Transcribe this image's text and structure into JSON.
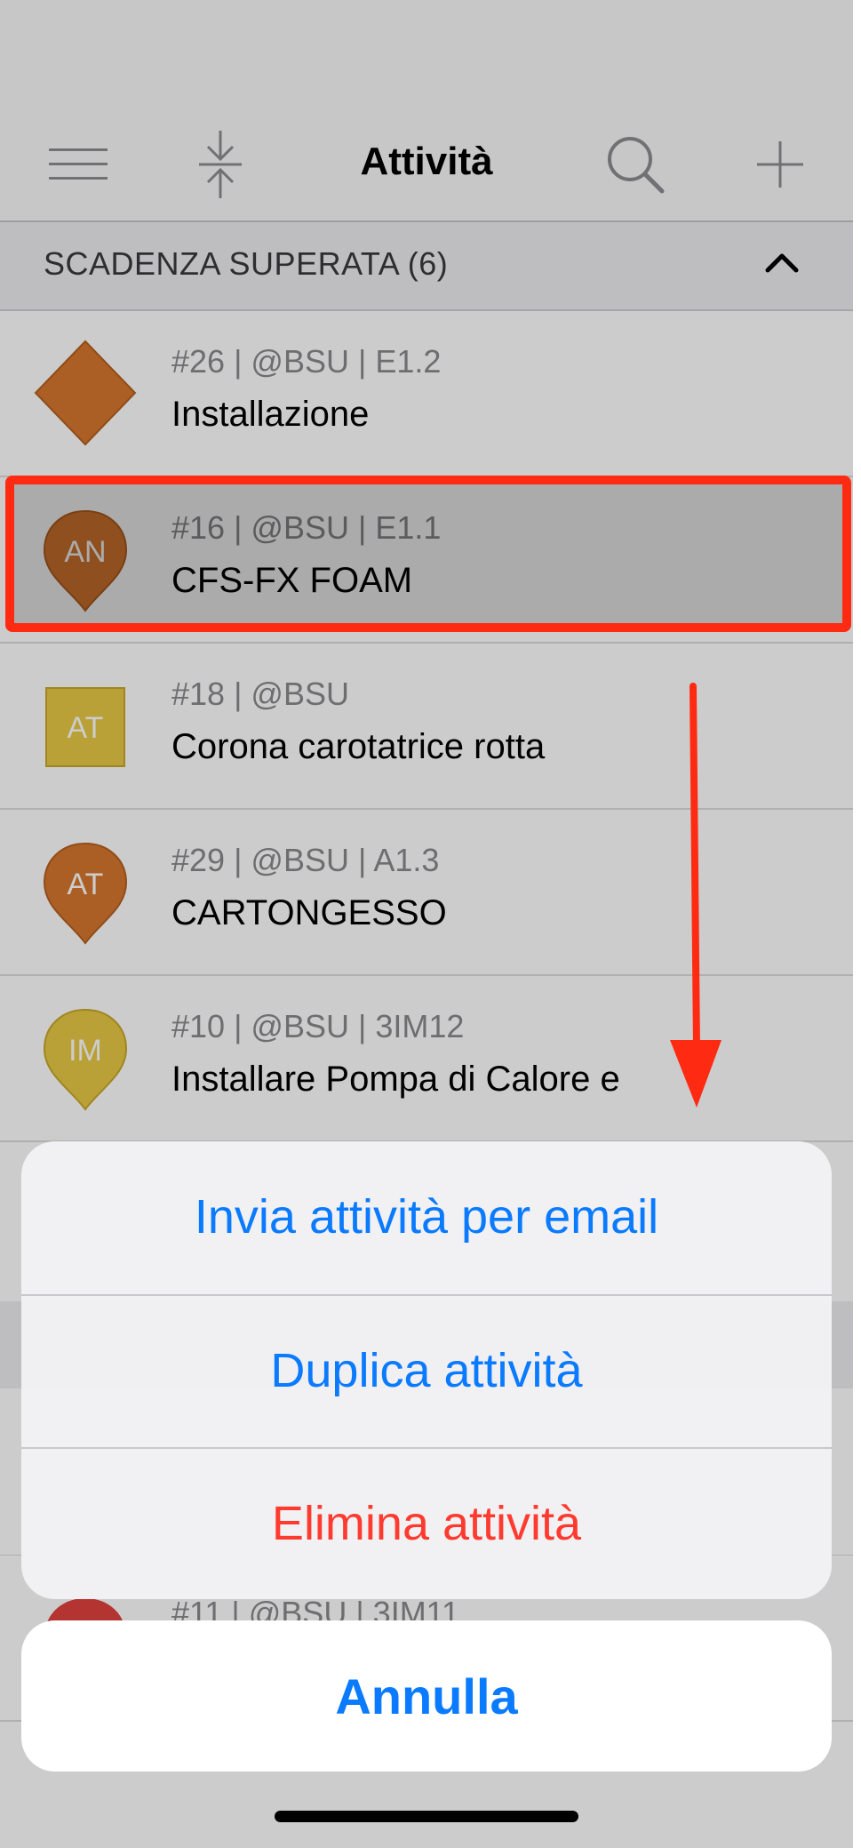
{
  "nav": {
    "title": "Attività",
    "menu_icon": "hamburger-menu-icon",
    "collapse_icon": "collapse-arrows-icon",
    "search_icon": "search-icon",
    "add_icon": "plus-icon"
  },
  "section": {
    "title": "SCADENZA SUPERATA (6)",
    "chevron_icon": "chevron-up-icon"
  },
  "tasks": [
    {
      "meta": "#26 | @BSU | E1.2",
      "title": "Installazione",
      "badge": "",
      "shape": "diamond",
      "color": "#d7772f"
    },
    {
      "meta": "#16 | @BSU | E1.1",
      "title": "CFS-FX FOAM",
      "badge": "AN",
      "shape": "pin",
      "color": "#d7772f"
    },
    {
      "meta": "#18 | @BSU",
      "title": "Corona carotatrice rotta",
      "badge": "AT",
      "shape": "square",
      "color": "#e8c845"
    },
    {
      "meta": "#29 | @BSU | A1.3",
      "title": "CARTONGESSO",
      "badge": "AT",
      "shape": "pin",
      "color": "#d7772f"
    },
    {
      "meta": "#10 | @BSU | 3IM12",
      "title": "Installare Pompa di Calore e",
      "badge": "IM",
      "shape": "pin",
      "color": "#e8c845"
    }
  ],
  "partial_row": {
    "meta": "#11 | @BSU | 3IM11",
    "color": "#e0413d"
  },
  "action_sheet": {
    "email": "Invia attività per email",
    "duplicate": "Duplica attività",
    "delete": "Elimina attività",
    "cancel": "Annulla"
  },
  "colors": {
    "accent": "#0a7aff",
    "destructive": "#ff3b30",
    "annotation": "#ff2a12"
  }
}
